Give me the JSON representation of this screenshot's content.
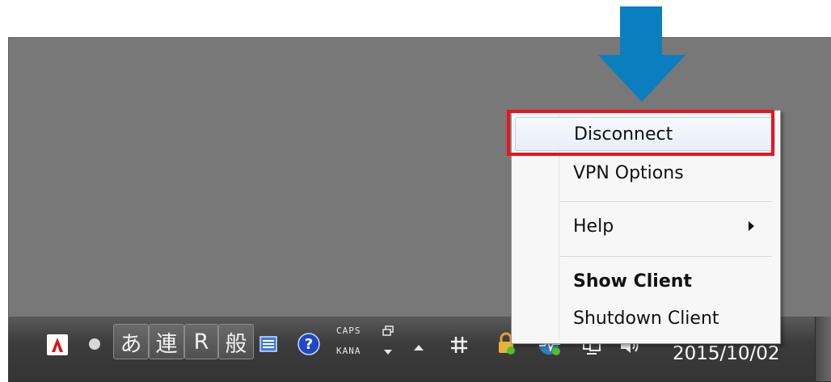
{
  "context_menu": {
    "items": [
      {
        "label": "Disconnect"
      },
      {
        "label": "VPN Options"
      },
      {
        "label": "Help"
      },
      {
        "label": "Show Client"
      },
      {
        "label": "Shutdown Client"
      }
    ]
  },
  "taskbar": {
    "ime": {
      "hiragana": "あ",
      "ren": "連",
      "r": "R",
      "han": "般"
    },
    "caps_label": "CAPS",
    "kana_label": "KANA",
    "date": "2015/10/02"
  },
  "colors": {
    "highlight": "#e8141e",
    "arrow": "#0a7ebf",
    "desktop": "#787878"
  },
  "icons": [
    "adobe-icon",
    "ime-mode-dot-icon",
    "ime-pad-icon",
    "help-icon",
    "restore-icon",
    "dropdown-icon",
    "show-hidden-icons-icon",
    "network-hash-icon",
    "lock-icon",
    "vpn-status-icon",
    "display-icon",
    "volume-icon"
  ]
}
